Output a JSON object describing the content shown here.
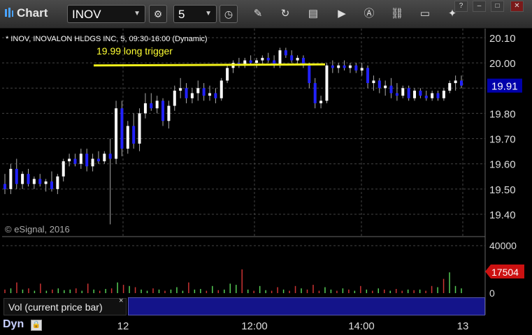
{
  "toolbar": {
    "title": "Chart",
    "symbol": "INOV",
    "interval": "5",
    "window_buttons": [
      "?",
      "–",
      "□",
      "✕"
    ]
  },
  "chart": {
    "header": "* INOV, INOVALON HLDGS INC, 5, 09:30-16:00 (Dynamic)",
    "annotation": "19.99 long trigger",
    "copyright": "© eSignal, 2016",
    "price_ticks": [
      "20.10",
      "20.00",
      "19.90",
      "19.80",
      "19.70",
      "19.60",
      "19.50",
      "19.40"
    ],
    "last_price": "19.91",
    "time_ticks": [
      "12",
      "12:00",
      "14:00",
      "13"
    ],
    "volume_ticks": [
      "40000",
      "0"
    ],
    "last_volume": "17504",
    "volume_panel_label": "Vol (current price bar)",
    "mode_label": "Dyn",
    "colors": {
      "up": "#ffffff",
      "down": "#2222ff",
      "trigger": "#ffff00",
      "last_volume_box": "#cc1111",
      "last_price_box": "#0000aa"
    }
  },
  "chart_data": {
    "type": "candlestick",
    "title": "",
    "price_ylim": [
      19.35,
      20.15
    ],
    "trigger_level": 19.99,
    "last_price": 19.91,
    "volume_ylim": [
      0,
      40000
    ],
    "last_volume": 17504,
    "candles": [
      {
        "o": 19.52,
        "h": 19.56,
        "l": 19.48,
        "c": 19.5
      },
      {
        "o": 19.5,
        "h": 19.6,
        "l": 19.48,
        "c": 19.58
      },
      {
        "o": 19.58,
        "h": 19.62,
        "l": 19.5,
        "c": 19.52
      },
      {
        "o": 19.52,
        "h": 19.57,
        "l": 19.5,
        "c": 19.56
      },
      {
        "o": 19.56,
        "h": 19.58,
        "l": 19.51,
        "c": 19.52
      },
      {
        "o": 19.52,
        "h": 19.55,
        "l": 19.5,
        "c": 19.54
      },
      {
        "o": 19.54,
        "h": 19.56,
        "l": 19.51,
        "c": 19.52
      },
      {
        "o": 19.52,
        "h": 19.54,
        "l": 19.49,
        "c": 19.53
      },
      {
        "o": 19.53,
        "h": 19.57,
        "l": 19.49,
        "c": 19.5
      },
      {
        "o": 19.5,
        "h": 19.56,
        "l": 19.48,
        "c": 19.55
      },
      {
        "o": 19.55,
        "h": 19.62,
        "l": 19.53,
        "c": 19.61
      },
      {
        "o": 19.61,
        "h": 19.64,
        "l": 19.59,
        "c": 19.62
      },
      {
        "o": 19.62,
        "h": 19.64,
        "l": 19.59,
        "c": 19.6
      },
      {
        "o": 19.6,
        "h": 19.66,
        "l": 19.58,
        "c": 19.64
      },
      {
        "o": 19.64,
        "h": 19.66,
        "l": 19.57,
        "c": 19.59
      },
      {
        "o": 19.59,
        "h": 19.64,
        "l": 19.57,
        "c": 19.62
      },
      {
        "o": 19.62,
        "h": 19.65,
        "l": 19.6,
        "c": 19.61
      },
      {
        "o": 19.61,
        "h": 19.65,
        "l": 19.6,
        "c": 19.64
      },
      {
        "o": 19.64,
        "h": 19.7,
        "l": 19.36,
        "c": 19.62
      },
      {
        "o": 19.62,
        "h": 19.85,
        "l": 19.6,
        "c": 19.82
      },
      {
        "o": 19.82,
        "h": 19.85,
        "l": 19.63,
        "c": 19.66
      },
      {
        "o": 19.66,
        "h": 19.77,
        "l": 19.64,
        "c": 19.75
      },
      {
        "o": 19.75,
        "h": 19.8,
        "l": 19.66,
        "c": 19.68
      },
      {
        "o": 19.68,
        "h": 19.82,
        "l": 19.65,
        "c": 19.8
      },
      {
        "o": 19.8,
        "h": 19.88,
        "l": 19.78,
        "c": 19.84
      },
      {
        "o": 19.84,
        "h": 19.88,
        "l": 19.81,
        "c": 19.82
      },
      {
        "o": 19.82,
        "h": 19.87,
        "l": 19.8,
        "c": 19.85
      },
      {
        "o": 19.85,
        "h": 19.86,
        "l": 19.75,
        "c": 19.77
      },
      {
        "o": 19.77,
        "h": 19.85,
        "l": 19.74,
        "c": 19.83
      },
      {
        "o": 19.83,
        "h": 19.91,
        "l": 19.81,
        "c": 19.89
      },
      {
        "o": 19.89,
        "h": 19.94,
        "l": 19.86,
        "c": 19.9
      },
      {
        "o": 19.9,
        "h": 19.92,
        "l": 19.84,
        "c": 19.86
      },
      {
        "o": 19.86,
        "h": 19.9,
        "l": 19.84,
        "c": 19.88
      },
      {
        "o": 19.88,
        "h": 19.93,
        "l": 19.85,
        "c": 19.9
      },
      {
        "o": 19.9,
        "h": 19.92,
        "l": 19.85,
        "c": 19.87
      },
      {
        "o": 19.87,
        "h": 19.91,
        "l": 19.85,
        "c": 19.88
      },
      {
        "o": 19.88,
        "h": 19.9,
        "l": 19.84,
        "c": 19.86
      },
      {
        "o": 19.86,
        "h": 19.94,
        "l": 19.85,
        "c": 19.93
      },
      {
        "o": 19.93,
        "h": 19.99,
        "l": 19.92,
        "c": 19.98
      },
      {
        "o": 19.98,
        "h": 20.01,
        "l": 19.96,
        "c": 20.0
      },
      {
        "o": 20.0,
        "h": 20.02,
        "l": 19.98,
        "c": 19.99
      },
      {
        "o": 19.99,
        "h": 20.02,
        "l": 19.98,
        "c": 20.01
      },
      {
        "o": 20.01,
        "h": 20.03,
        "l": 19.99,
        "c": 20.0
      },
      {
        "o": 20.0,
        "h": 20.02,
        "l": 19.98,
        "c": 20.01
      },
      {
        "o": 20.01,
        "h": 20.03,
        "l": 19.99,
        "c": 20.02
      },
      {
        "o": 20.02,
        "h": 20.04,
        "l": 20.0,
        "c": 20.01
      },
      {
        "o": 20.01,
        "h": 20.03,
        "l": 19.98,
        "c": 19.99
      },
      {
        "o": 19.99,
        "h": 20.06,
        "l": 19.98,
        "c": 20.05
      },
      {
        "o": 20.05,
        "h": 20.06,
        "l": 20.02,
        "c": 20.03
      },
      {
        "o": 20.03,
        "h": 20.05,
        "l": 20.0,
        "c": 20.01
      },
      {
        "o": 20.01,
        "h": 20.03,
        "l": 19.99,
        "c": 20.02
      },
      {
        "o": 20.02,
        "h": 20.03,
        "l": 19.98,
        "c": 19.99
      },
      {
        "o": 19.99,
        "h": 20.0,
        "l": 19.9,
        "c": 19.92
      },
      {
        "o": 19.92,
        "h": 19.94,
        "l": 19.82,
        "c": 19.84
      },
      {
        "o": 19.84,
        "h": 19.87,
        "l": 19.82,
        "c": 19.85
      },
      {
        "o": 19.85,
        "h": 20.0,
        "l": 19.84,
        "c": 19.99
      },
      {
        "o": 19.99,
        "h": 20.01,
        "l": 19.96,
        "c": 19.98
      },
      {
        "o": 19.98,
        "h": 20.0,
        "l": 19.96,
        "c": 19.99
      },
      {
        "o": 19.99,
        "h": 20.01,
        "l": 19.97,
        "c": 19.98
      },
      {
        "o": 19.98,
        "h": 20.0,
        "l": 19.96,
        "c": 19.99
      },
      {
        "o": 19.99,
        "h": 20.0,
        "l": 19.96,
        "c": 19.97
      },
      {
        "o": 19.97,
        "h": 20.0,
        "l": 19.95,
        "c": 19.98
      },
      {
        "o": 19.98,
        "h": 19.99,
        "l": 19.9,
        "c": 19.92
      },
      {
        "o": 19.92,
        "h": 19.95,
        "l": 19.89,
        "c": 19.93
      },
      {
        "o": 19.93,
        "h": 19.94,
        "l": 19.88,
        "c": 19.9
      },
      {
        "o": 19.9,
        "h": 19.93,
        "l": 19.87,
        "c": 19.91
      },
      {
        "o": 19.91,
        "h": 19.94,
        "l": 19.86,
        "c": 19.88
      },
      {
        "o": 19.88,
        "h": 19.92,
        "l": 19.85,
        "c": 19.87
      },
      {
        "o": 19.87,
        "h": 19.91,
        "l": 19.86,
        "c": 19.9
      },
      {
        "o": 19.9,
        "h": 19.91,
        "l": 19.85,
        "c": 19.86
      },
      {
        "o": 19.86,
        "h": 19.9,
        "l": 19.85,
        "c": 19.89
      },
      {
        "o": 19.89,
        "h": 19.9,
        "l": 19.86,
        "c": 19.87
      },
      {
        "o": 19.87,
        "h": 19.89,
        "l": 19.85,
        "c": 19.86
      },
      {
        "o": 19.86,
        "h": 19.89,
        "l": 19.85,
        "c": 19.88
      },
      {
        "o": 19.88,
        "h": 19.89,
        "l": 19.85,
        "c": 19.86
      },
      {
        "o": 19.86,
        "h": 19.9,
        "l": 19.85,
        "c": 19.89
      },
      {
        "o": 19.89,
        "h": 19.93,
        "l": 19.88,
        "c": 19.92
      },
      {
        "o": 19.92,
        "h": 19.95,
        "l": 19.89,
        "c": 19.93
      },
      {
        "o": 19.93,
        "h": 19.95,
        "l": 19.9,
        "c": 19.91
      }
    ],
    "volumes": [
      3000,
      4000,
      9000,
      3000,
      4000,
      2000,
      8000,
      2000,
      3000,
      4000,
      2500,
      3000,
      4000,
      2000,
      8000,
      3000,
      2000,
      3500,
      4000,
      9000,
      7000,
      6000,
      5000,
      3000,
      2000,
      4000,
      3000,
      2000,
      3000,
      5000,
      2000,
      9000,
      3000,
      3500,
      2000,
      6000,
      2500,
      3000,
      8000,
      7000,
      20000,
      3000,
      2000,
      6000,
      2500,
      2000,
      5000,
      3000,
      2000,
      6000,
      4000,
      3000,
      7000,
      2000,
      5000,
      3000,
      2000,
      4000,
      3000,
      2000,
      6000,
      3000,
      2000,
      4000,
      3000,
      2000,
      3500,
      2000,
      3000,
      2500,
      3000,
      2000,
      6000,
      5000,
      12000,
      17504,
      6000,
      4000
    ]
  }
}
